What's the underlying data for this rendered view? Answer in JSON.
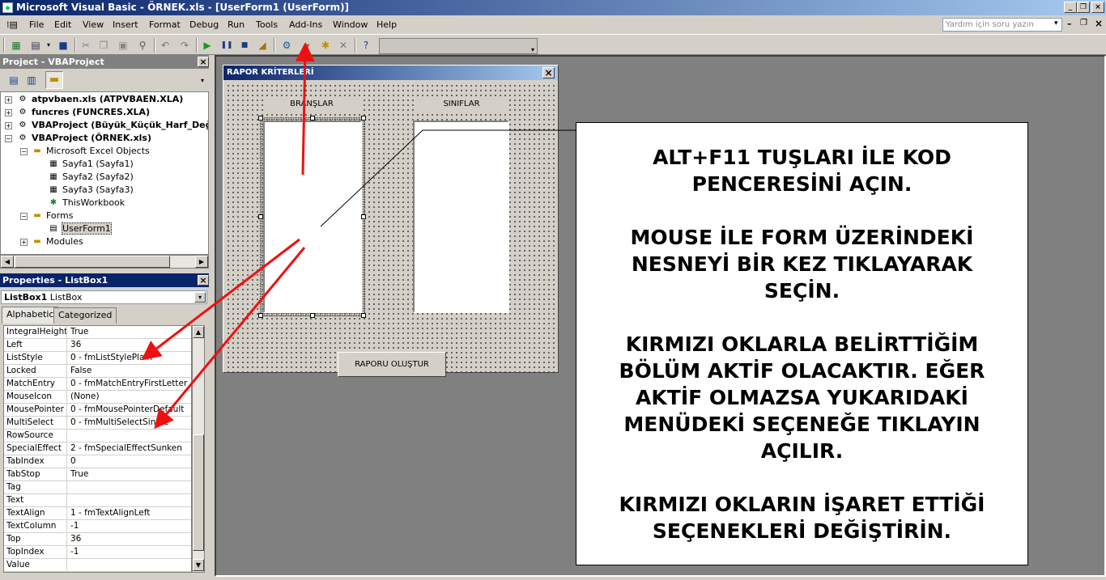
{
  "window": {
    "title": "Microsoft Visual Basic - ÖRNEK.xls - [UserForm1 (UserForm)]"
  },
  "menu": [
    "File",
    "Edit",
    "View",
    "Insert",
    "Format",
    "Debug",
    "Run",
    "Tools",
    "Add-Ins",
    "Window",
    "Help"
  ],
  "help_box": {
    "placeholder": "Yardım için soru yazın"
  },
  "project_panel": {
    "title": "Project - VBAProject",
    "nodes": [
      {
        "label": "atpvbaen.xls (ATPVBAEN.XLA)"
      },
      {
        "label": "funcres (FUNCRES.XLA)"
      },
      {
        "label": "VBAProject (Büyük_Küçük_Harf_Değiş"
      },
      {
        "label": "VBAProject (ÖRNEK.xls)"
      },
      {
        "label": "Microsoft Excel Objects"
      },
      {
        "label": "Sayfa1 (Sayfa1)"
      },
      {
        "label": "Sayfa2 (Sayfa2)"
      },
      {
        "label": "Sayfa3 (Sayfa3)"
      },
      {
        "label": "ThisWorkbook"
      },
      {
        "label": "Forms"
      },
      {
        "label": "UserForm1"
      },
      {
        "label": "Modules"
      }
    ]
  },
  "properties_panel": {
    "title": "Properties - ListBox1",
    "object_name": "ListBox1",
    "object_type": "ListBox",
    "tabs": [
      "Alphabetic",
      "Categorized"
    ],
    "rows": [
      [
        "IntegralHeight",
        "True"
      ],
      [
        "Left",
        "36"
      ],
      [
        "ListStyle",
        "0 - fmListStylePlain"
      ],
      [
        "Locked",
        "False"
      ],
      [
        "MatchEntry",
        "0 - fmMatchEntryFirstLetter"
      ],
      [
        "MouseIcon",
        "(None)"
      ],
      [
        "MousePointer",
        "0 - fmMousePointerDefault"
      ],
      [
        "MultiSelect",
        "0 - fmMultiSelectSingle"
      ],
      [
        "RowSource",
        ""
      ],
      [
        "SpecialEffect",
        "2 - fmSpecialEffectSunken"
      ],
      [
        "TabIndex",
        "0"
      ],
      [
        "TabStop",
        "True"
      ],
      [
        "Tag",
        ""
      ],
      [
        "Text",
        ""
      ],
      [
        "TextAlign",
        "1 - fmTextAlignLeft"
      ],
      [
        "TextColumn",
        "-1"
      ],
      [
        "Top",
        "36"
      ],
      [
        "TopIndex",
        "-1"
      ],
      [
        "Value",
        ""
      ]
    ]
  },
  "userform": {
    "title": "RAPOR KRİTERLERİ",
    "label_left": "BRANŞLAR",
    "label_right": "SINIFLAR",
    "button": "RAPORU OLUŞTUR"
  },
  "callout": {
    "lines": [
      "ALT+F11 TUŞLARI İLE KOD",
      "PENCERESİNİ AÇIN.",
      "",
      "MOUSE İLE FORM ÜZERİNDEKİ",
      "NESNEYİ BİR KEZ TIKLAYARAK",
      "SEÇİN.",
      "",
      "KIRMIZI OKLARLA BELİRTTİĞİM",
      "BÖLÜM AKTİF OLACAKTIR. EĞER",
      "AKTİF OLMAZSA YUKARIDAKİ",
      "MENÜDEKİ SEÇENEĞE TIKLAYIN",
      "AÇILIR.",
      "",
      "KIRMIZI OKLARIN İŞARET ETTİĞİ",
      "SEÇENEKLERİ DEĞİŞTİRİN."
    ]
  },
  "colors": {
    "arrow": "#ee1111",
    "titlebar": "#0a246a"
  }
}
